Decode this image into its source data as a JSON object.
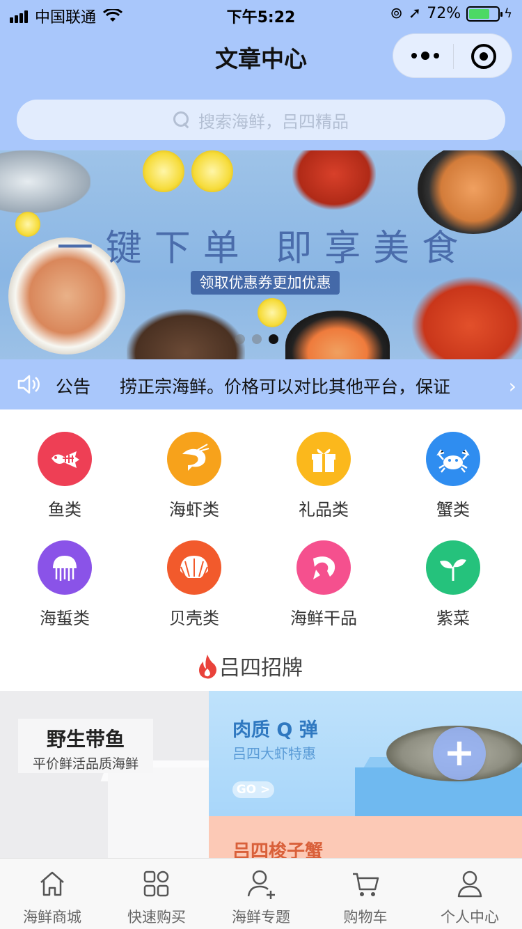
{
  "status_bar": {
    "carrier": "中国联通",
    "time": "下午5:22",
    "battery": "72%",
    "battery_level": 0.72
  },
  "nav": {
    "title": "文章中心"
  },
  "search": {
    "placeholder": "搜索海鲜，吕四精品"
  },
  "banner": {
    "slogan": "一键下单 即享美食",
    "coupon_label": "领取优惠券更加优惠",
    "slide_count": 3,
    "active_slide": 3
  },
  "notice": {
    "label": "公告",
    "text": "捞正宗海鲜。价格可以对比其他平台，保证"
  },
  "categories": [
    {
      "name": "鱼类",
      "icon": "fish-bone-icon",
      "color": "#ee3f55"
    },
    {
      "name": "海虾类",
      "icon": "shrimp-icon",
      "color": "#f7a21b"
    },
    {
      "name": "礼品类",
      "icon": "gift-icon",
      "color": "#fbb81c"
    },
    {
      "name": "蟹类",
      "icon": "crab-icon",
      "color": "#2f8df0"
    },
    {
      "name": "海蜇类",
      "icon": "jellyfish-icon",
      "color": "#8a53e8"
    },
    {
      "name": "贝壳类",
      "icon": "shell-icon",
      "color": "#f25a2c"
    },
    {
      "name": "海鲜干品",
      "icon": "dried-seafood-icon",
      "color": "#f5508e"
    },
    {
      "name": "紫菜",
      "icon": "sprout-icon",
      "color": "#25c27c"
    }
  ],
  "section": {
    "title": "吕四招牌"
  },
  "promos": {
    "left": {
      "title": "野生带鱼",
      "subtitle": "平价鲜活品质海鲜"
    },
    "right_top": {
      "title": "肉质 Q 弹",
      "subtitle": "吕四大虾特惠",
      "cta": "GO >"
    },
    "right_bottom": {
      "title": "吕四梭子蟹"
    }
  },
  "tabs": [
    {
      "label": "海鲜商城",
      "icon": "home-icon"
    },
    {
      "label": "快速购买",
      "icon": "grid-icon"
    },
    {
      "label": "海鲜专题",
      "icon": "user-add-icon"
    },
    {
      "label": "购物车",
      "icon": "cart-icon"
    },
    {
      "label": "个人中心",
      "icon": "person-icon"
    }
  ]
}
